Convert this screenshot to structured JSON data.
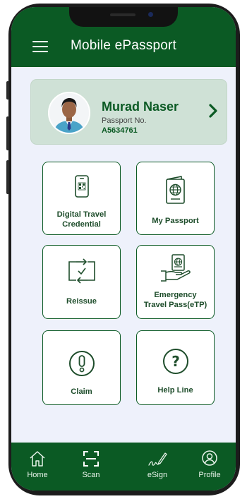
{
  "header": {
    "title": "Mobile ePassport"
  },
  "profile": {
    "name": "Murad Naser",
    "passport_label": "Passport No.",
    "passport_number": "A5634761"
  },
  "tiles": {
    "digital_travel_credential": {
      "line1": "Digital Travel",
      "line2": "Credential"
    },
    "my_passport": "My Passport",
    "reissue": "Reissue",
    "emergency_travel_pass": {
      "line1": "Emergency",
      "line2": "Travel Pass(eTP)"
    },
    "claim": "Claim",
    "help_line": "Help Line"
  },
  "bottom_nav": {
    "home": "Home",
    "scan": "Scan",
    "esign": "eSign",
    "profile": "Profile"
  },
  "colors": {
    "primary": "#0b5a24",
    "background": "#eef1fb",
    "card": "#cfe1d6"
  }
}
